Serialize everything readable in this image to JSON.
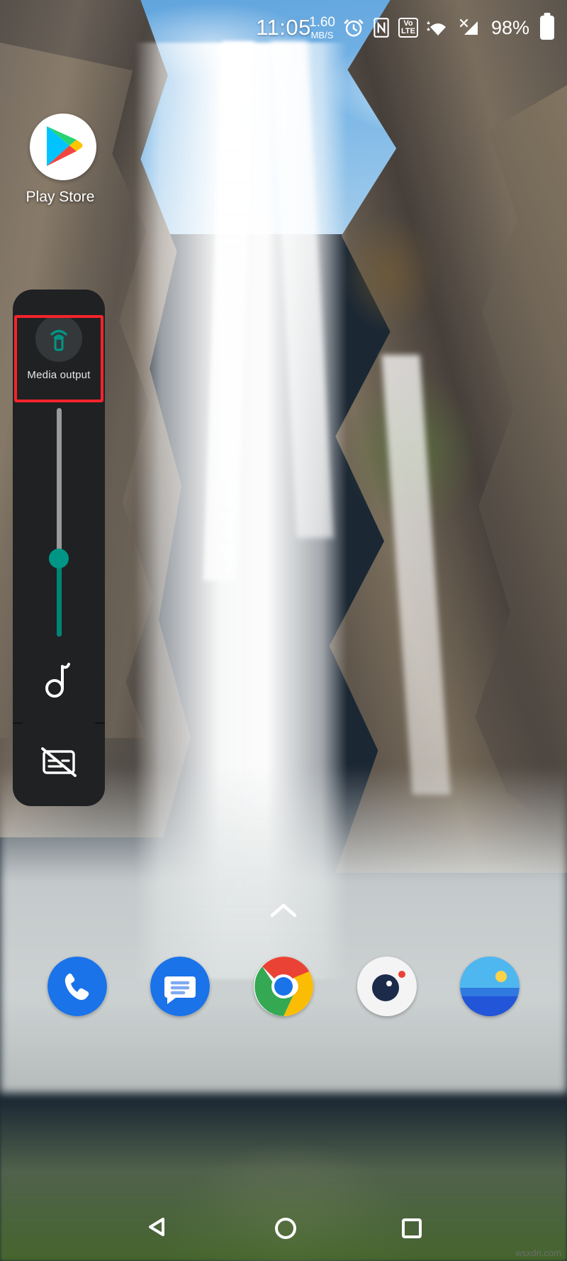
{
  "status_bar": {
    "time": "11:05",
    "network_speed_value": "1.60",
    "network_speed_unit": "MB/S",
    "alarm_icon": "alarm-clock-icon",
    "nfc_icon": "nfc-icon",
    "volte_top": "Vo",
    "volte_bottom": "LTE",
    "wifi_icon": "wifi-icon",
    "signal_icon": "cellular-signal-no-sim-icon",
    "battery_percent": "98%",
    "battery_icon": "battery-full-icon"
  },
  "home": {
    "app_icon_label": "Play Store"
  },
  "volume_panel": {
    "media_output": {
      "label": "Media output",
      "icon": "cast-to-device-icon",
      "highlight_color": "#f4232c",
      "accent_color": "#009685"
    },
    "slider": {
      "name": "media-volume-slider",
      "track_color": "#9a9a9a",
      "fill_color": "#008577",
      "thumb_color": "#009685",
      "level_percent": 35
    },
    "stream_icon": "music-note-icon",
    "settings_icon": "volume-settings-sliders-icon",
    "captions_icon": "captions-off-icon"
  },
  "dock": {
    "drawer_handle_icon": "chevron-up-icon",
    "apps": [
      {
        "name": "phone",
        "icon": "phone-icon"
      },
      {
        "name": "messages",
        "icon": "messages-icon"
      },
      {
        "name": "chrome",
        "icon": "chrome-icon"
      },
      {
        "name": "camera",
        "icon": "camera-icon"
      },
      {
        "name": "photos",
        "icon": "photos-gallery-icon"
      }
    ]
  },
  "nav_bar": {
    "back_icon": "back-triangle-icon",
    "home_icon": "home-circle-icon",
    "recents_icon": "recents-square-icon"
  },
  "watermark": "wsxdn.com"
}
